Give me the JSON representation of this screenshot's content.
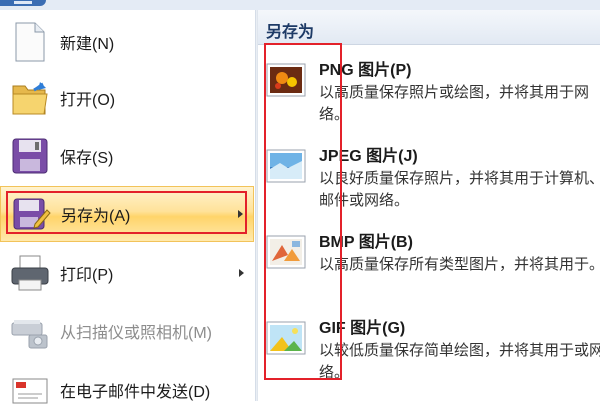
{
  "menu": {
    "items": [
      {
        "label": "新建(N)",
        "icon": "new-document-icon",
        "enabled": true,
        "submenu": false
      },
      {
        "label": "打开(O)",
        "icon": "open-folder-icon",
        "enabled": true,
        "submenu": false
      },
      {
        "label": "保存(S)",
        "icon": "save-floppy-icon",
        "enabled": true,
        "submenu": false
      },
      {
        "label": "另存为(A)",
        "icon": "save-as-icon",
        "enabled": true,
        "submenu": true,
        "selected": true
      },
      {
        "label": "打印(P)",
        "icon": "printer-icon",
        "enabled": true,
        "submenu": true
      },
      {
        "label": "从扫描仪或照相机(M)",
        "icon": "scanner-camera-icon",
        "enabled": false,
        "submenu": false
      },
      {
        "label": "在电子邮件中发送(D)",
        "icon": "email-icon",
        "enabled": true,
        "submenu": false
      }
    ]
  },
  "panel": {
    "title": "另存为",
    "options": [
      {
        "title": "PNG 图片(P)",
        "desc": "以高质量保存照片或绘图，并将其用于网络。",
        "icon": "png-image-icon"
      },
      {
        "title": "JPEG 图片(J)",
        "desc": "以良好质量保存照片，并将其用于计算机、邮件或网络。",
        "icon": "jpeg-image-icon"
      },
      {
        "title": "BMP 图片(B)",
        "desc": "以高质量保存所有类型图片，并将其用于。",
        "icon": "bmp-image-icon"
      },
      {
        "title": "GIF 图片(G)",
        "desc": "以较低质量保存简单绘图，并将其用于或网络。",
        "icon": "gif-image-icon"
      }
    ]
  },
  "colors": {
    "highlight": "#ffd46a",
    "annotation_red": "#e3212a",
    "header_text": "#1d3a66"
  }
}
